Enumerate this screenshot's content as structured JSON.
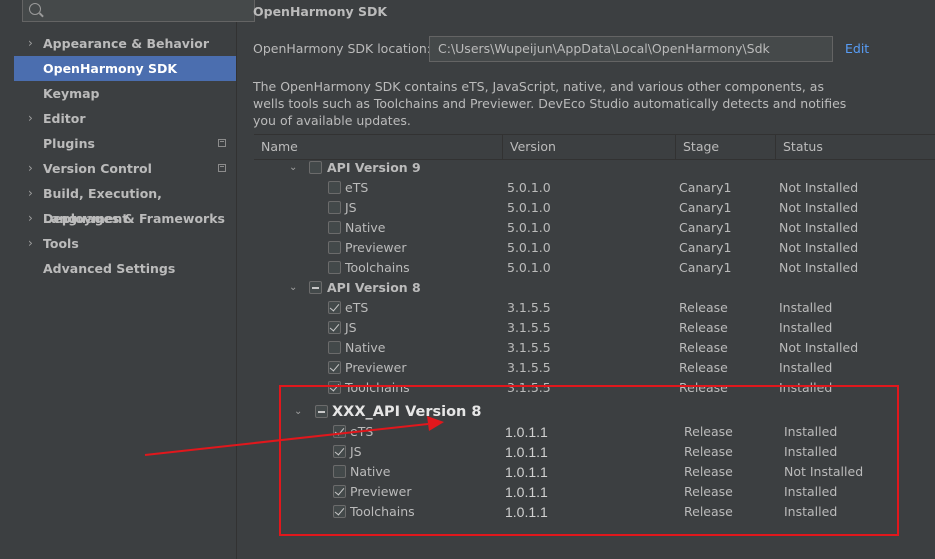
{
  "sidebar": {
    "search_placeholder": "",
    "items": [
      {
        "label": "Appearance & Behavior",
        "chevron": "›"
      },
      {
        "label": "OpenHarmony SDK",
        "chevron": ""
      },
      {
        "label": "Keymap",
        "chevron": ""
      },
      {
        "label": "Editor",
        "chevron": "›"
      },
      {
        "label": "Plugins",
        "chevron": ""
      },
      {
        "label": "Version Control",
        "chevron": "›"
      },
      {
        "label": "Build, Execution, Deployment",
        "chevron": "›"
      },
      {
        "label": "Languages & Frameworks",
        "chevron": "›"
      },
      {
        "label": "Tools",
        "chevron": "›"
      },
      {
        "label": "Advanced Settings",
        "chevron": ""
      }
    ],
    "selected_index": 1
  },
  "main": {
    "title": "OpenHarmony SDK",
    "location_label": "OpenHarmony SDK location:",
    "location_value": "C:\\Users\\Wupeijun\\AppData\\Local\\OpenHarmony\\Sdk",
    "edit_label": "Edit",
    "description": "The OpenHarmony SDK contains eTS, JavaScript, native, and various other components, as wells tools such as Toolchains and Previewer. DevEco Studio automatically detects and notifies you of available updates."
  },
  "table": {
    "headers": {
      "name": "Name",
      "version": "Version",
      "stage": "Stage",
      "status": "Status"
    },
    "groups": [
      {
        "label": "API Version 9",
        "state": "unchecked",
        "toggle": "⌄",
        "items": [
          {
            "name": "eTS",
            "version": "5.0.1.0",
            "stage": "Canary1",
            "status": "Not Installed",
            "checked": false
          },
          {
            "name": "JS",
            "version": "5.0.1.0",
            "stage": "Canary1",
            "status": "Not Installed",
            "checked": false
          },
          {
            "name": "Native",
            "version": "5.0.1.0",
            "stage": "Canary1",
            "status": "Not Installed",
            "checked": false
          },
          {
            "name": "Previewer",
            "version": "5.0.1.0",
            "stage": "Canary1",
            "status": "Not Installed",
            "checked": false
          },
          {
            "name": "Toolchains",
            "version": "5.0.1.0",
            "stage": "Canary1",
            "status": "Not Installed",
            "checked": false
          }
        ]
      },
      {
        "label": "API Version 8",
        "state": "partial",
        "toggle": "⌄",
        "items": [
          {
            "name": "eTS",
            "version": "3.1.5.5",
            "stage": "Release",
            "status": "Installed",
            "checked": true
          },
          {
            "name": "JS",
            "version": "3.1.5.5",
            "stage": "Release",
            "status": "Installed",
            "checked": true
          },
          {
            "name": "Native",
            "version": "3.1.5.5",
            "stage": "Release",
            "status": "Not Installed",
            "checked": false
          },
          {
            "name": "Previewer",
            "version": "3.1.5.5",
            "stage": "Release",
            "status": "Installed",
            "checked": true
          },
          {
            "name": "Toolchains",
            "version": "3.1.5.5",
            "stage": "Release",
            "status": "Installed",
            "checked": true
          }
        ]
      }
    ],
    "annotated_group": {
      "label": "XXX_API Version 8",
      "state": "partial",
      "toggle": "⌄",
      "items": [
        {
          "name": "eTS",
          "version": "1.0.1.1",
          "stage": "Release",
          "status": "Installed",
          "checked": true
        },
        {
          "name": "JS",
          "version": "1.0.1.1",
          "stage": "Release",
          "status": "Installed",
          "checked": true
        },
        {
          "name": "Native",
          "version": "1.0.1.1",
          "stage": "Release",
          "status": "Not Installed",
          "checked": false
        },
        {
          "name": "Previewer",
          "version": "1.0.1.1",
          "stage": "Release",
          "status": "Installed",
          "checked": true
        },
        {
          "name": "Toolchains",
          "version": "1.0.1.1",
          "stage": "Release",
          "status": "Installed",
          "checked": true
        }
      ]
    }
  },
  "annotation": {
    "color": "#e1171c"
  },
  "colors": {
    "selected_bg": "#4b6eaf",
    "link": "#589df6",
    "panel_bg": "#3c3f41"
  }
}
